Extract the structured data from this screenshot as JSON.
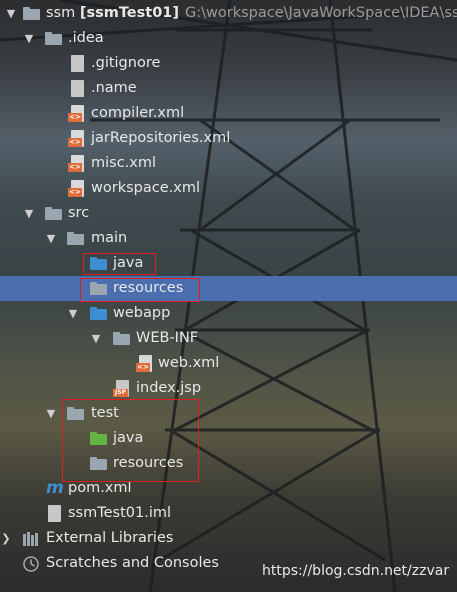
{
  "tree": {
    "root": {
      "name": "ssm",
      "module": "[ssmTest01]",
      "path": "G:\\workspace\\JavaWorkSpace\\IDEA\\ssm"
    },
    "idea": {
      "label": ".idea"
    },
    "gitignore": {
      "label": ".gitignore"
    },
    "name_file": {
      "label": ".name"
    },
    "compiler": {
      "label": "compiler.xml"
    },
    "jarrepos": {
      "label": "jarRepositories.xml"
    },
    "misc": {
      "label": "misc.xml"
    },
    "workspace": {
      "label": "workspace.xml"
    },
    "src": {
      "label": "src"
    },
    "main": {
      "label": "main"
    },
    "main_java": {
      "label": "java"
    },
    "main_resources": {
      "label": "resources"
    },
    "webapp": {
      "label": "webapp"
    },
    "webinf": {
      "label": "WEB-INF"
    },
    "webxml": {
      "label": "web.xml"
    },
    "indexjsp": {
      "label": "index.jsp"
    },
    "test": {
      "label": "test"
    },
    "test_java": {
      "label": "java"
    },
    "test_resources": {
      "label": "resources"
    },
    "pom": {
      "label": "pom.xml"
    },
    "iml": {
      "label": "ssmTest01.iml"
    },
    "extlibs": {
      "label": "External Libraries"
    },
    "scratches": {
      "label": "Scratches and Consoles"
    }
  },
  "badges": {
    "xml": "<>",
    "jsp": "JSP"
  },
  "watermark": "https://blog.csdn.net/zzvar",
  "colors": {
    "selection": "#4b6eaf",
    "highlight_box": "#e02020",
    "source_folder": "#3d8fd1",
    "test_folder": "#62b543"
  }
}
